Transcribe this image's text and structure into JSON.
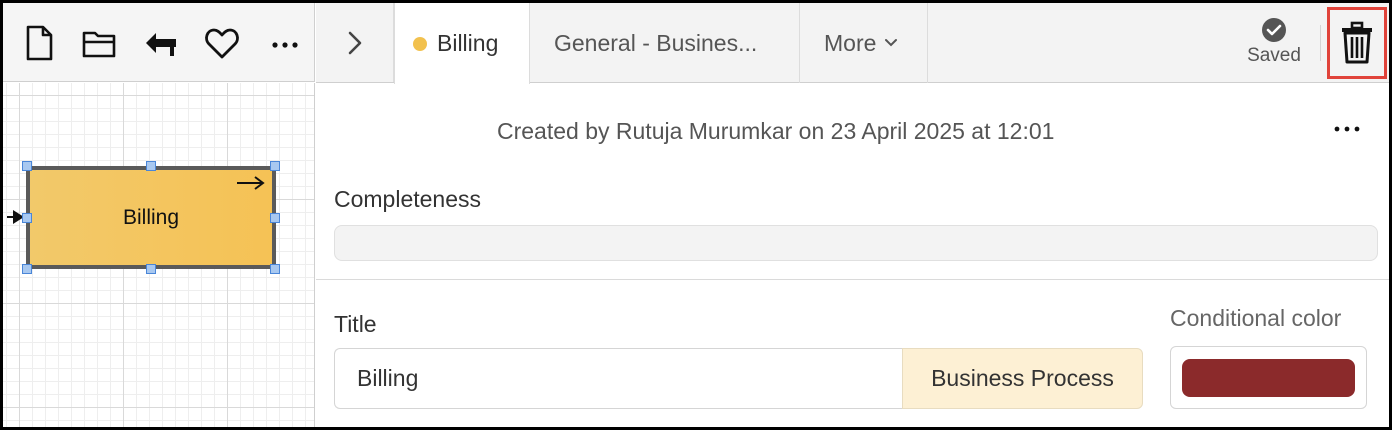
{
  "toolbar": {
    "icons": [
      "new-document-icon",
      "open-folder-icon",
      "back-icon",
      "favorite-heart-icon",
      "more-horizontal-icon"
    ]
  },
  "canvas": {
    "shape_label": "Billing"
  },
  "tabs": {
    "items": [
      {
        "label": "Billing",
        "active": true,
        "dot_color": "#f2c14e"
      },
      {
        "label": "General - Busines...",
        "active": false
      },
      {
        "label": "More",
        "active": false
      }
    ],
    "saved_label": "Saved"
  },
  "panel": {
    "created_text": "Created by Rutuja Murumkar on 23 April 2025 at 12:01",
    "completeness_label": "Completeness",
    "completeness_value": 0,
    "title_label": "Title",
    "title_value": "Billing",
    "type_badge": "Business Process",
    "conditional_color_label": "Conditional color",
    "conditional_color": "#8b2a2b"
  },
  "colors": {
    "accent_yellow": "#f2c14e",
    "highlight_red": "#e0433a"
  }
}
